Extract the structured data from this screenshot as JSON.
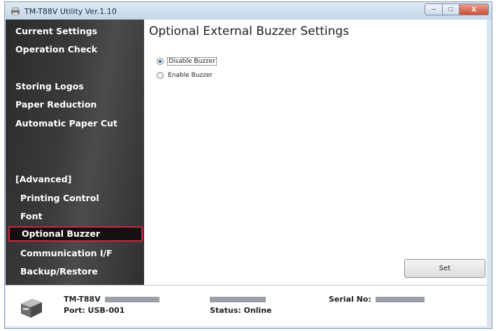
{
  "window": {
    "title": "TM-T88V Utility Ver.1.10",
    "controls": {
      "minimize": "–",
      "maximize": "□",
      "close": "X"
    }
  },
  "sidebar": {
    "items": [
      {
        "label": "Current Settings"
      },
      {
        "label": "Operation Check"
      },
      {
        "label": "Storing Logos"
      },
      {
        "label": "Paper Reduction"
      },
      {
        "label": "Automatic Paper Cut"
      },
      {
        "label": "[Advanced]"
      },
      {
        "label": "Printing Control"
      },
      {
        "label": "Font"
      },
      {
        "label": "Optional Buzzer",
        "selected": true
      },
      {
        "label": "Communication I/F"
      },
      {
        "label": "Backup/Restore"
      }
    ]
  },
  "main": {
    "title": "Optional External Buzzer Settings",
    "options": [
      {
        "label": "Disable Buzzer",
        "checked": true
      },
      {
        "label": "Enable Buzzer",
        "checked": false
      }
    ],
    "set_button": "Set"
  },
  "footer": {
    "model": "TM-T88V",
    "port": "Port: USB-001",
    "status": "Status: Online",
    "serial_label": "Serial No:"
  },
  "colors": {
    "selected_border": "#c22b3a",
    "sidebar_bg": "#333333",
    "radio_dot": "#1f5fbf"
  },
  "icons": {
    "app": "printer-app-icon",
    "printer": "printer-icon"
  }
}
